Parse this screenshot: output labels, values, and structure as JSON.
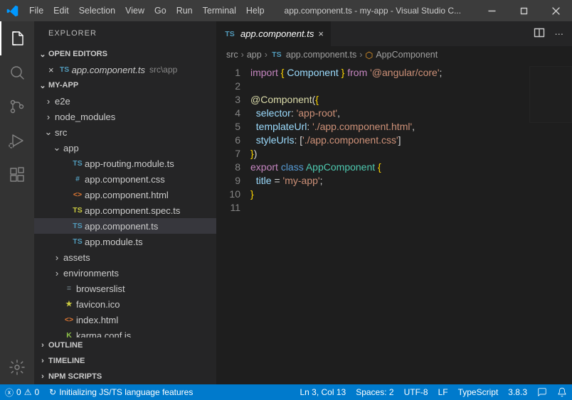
{
  "window": {
    "title": "app.component.ts - my-app - Visual Studio C..."
  },
  "menu": [
    "File",
    "Edit",
    "Selection",
    "View",
    "Go",
    "Run",
    "Terminal",
    "Help"
  ],
  "sidebar": {
    "title": "EXPLORER",
    "sections": {
      "open_editors": "OPEN EDITORS",
      "project": "MY-APP",
      "outline": "OUTLINE",
      "timeline": "TIMELINE",
      "npm": "NPM SCRIPTS"
    },
    "open_editor": {
      "file": "app.component.ts",
      "dir": "src\\app",
      "icon": "TS"
    },
    "tree": [
      {
        "d": 1,
        "t": "folder",
        "open": false,
        "name": "e2e"
      },
      {
        "d": 1,
        "t": "folder",
        "open": false,
        "name": "node_modules"
      },
      {
        "d": 1,
        "t": "folder",
        "open": true,
        "name": "src"
      },
      {
        "d": 2,
        "t": "folder",
        "open": true,
        "name": "app"
      },
      {
        "d": 3,
        "t": "file",
        "icon": "TS",
        "ic": "#519aba",
        "name": "app-routing.module.ts"
      },
      {
        "d": 3,
        "t": "file",
        "icon": "#",
        "ic": "#519aba",
        "name": "app.component.css"
      },
      {
        "d": 3,
        "t": "file",
        "icon": "<>",
        "ic": "#e37933",
        "name": "app.component.html"
      },
      {
        "d": 3,
        "t": "file",
        "icon": "TS",
        "ic": "#cbcb41",
        "name": "app.component.spec.ts"
      },
      {
        "d": 3,
        "t": "file",
        "icon": "TS",
        "ic": "#519aba",
        "name": "app.component.ts",
        "sel": true
      },
      {
        "d": 3,
        "t": "file",
        "icon": "TS",
        "ic": "#519aba",
        "name": "app.module.ts"
      },
      {
        "d": 2,
        "t": "folder",
        "open": false,
        "name": "assets"
      },
      {
        "d": 2,
        "t": "folder",
        "open": false,
        "name": "environments"
      },
      {
        "d": 2,
        "t": "file",
        "icon": "≡",
        "ic": "#6d8086",
        "name": "browserslist"
      },
      {
        "d": 2,
        "t": "file",
        "icon": "★",
        "ic": "#cbcb41",
        "name": "favicon.ico"
      },
      {
        "d": 2,
        "t": "file",
        "icon": "<>",
        "ic": "#e37933",
        "name": "index.html"
      },
      {
        "d": 2,
        "t": "file",
        "icon": "K",
        "ic": "#8dc149",
        "name": "karma.conf.js"
      }
    ]
  },
  "editor": {
    "tab": {
      "icon": "TS",
      "name": "app.component.ts"
    },
    "breadcrumb": [
      "src",
      "app",
      "app.component.ts",
      "AppComponent"
    ],
    "lines": 11
  },
  "status": {
    "errors": "0",
    "warnings": "0",
    "task": "Initializing JS/TS language features",
    "pos": "Ln 3, Col 13",
    "spaces": "Spaces: 2",
    "enc": "UTF-8",
    "eol": "LF",
    "lang": "TypeScript",
    "ver": "3.8.3"
  }
}
